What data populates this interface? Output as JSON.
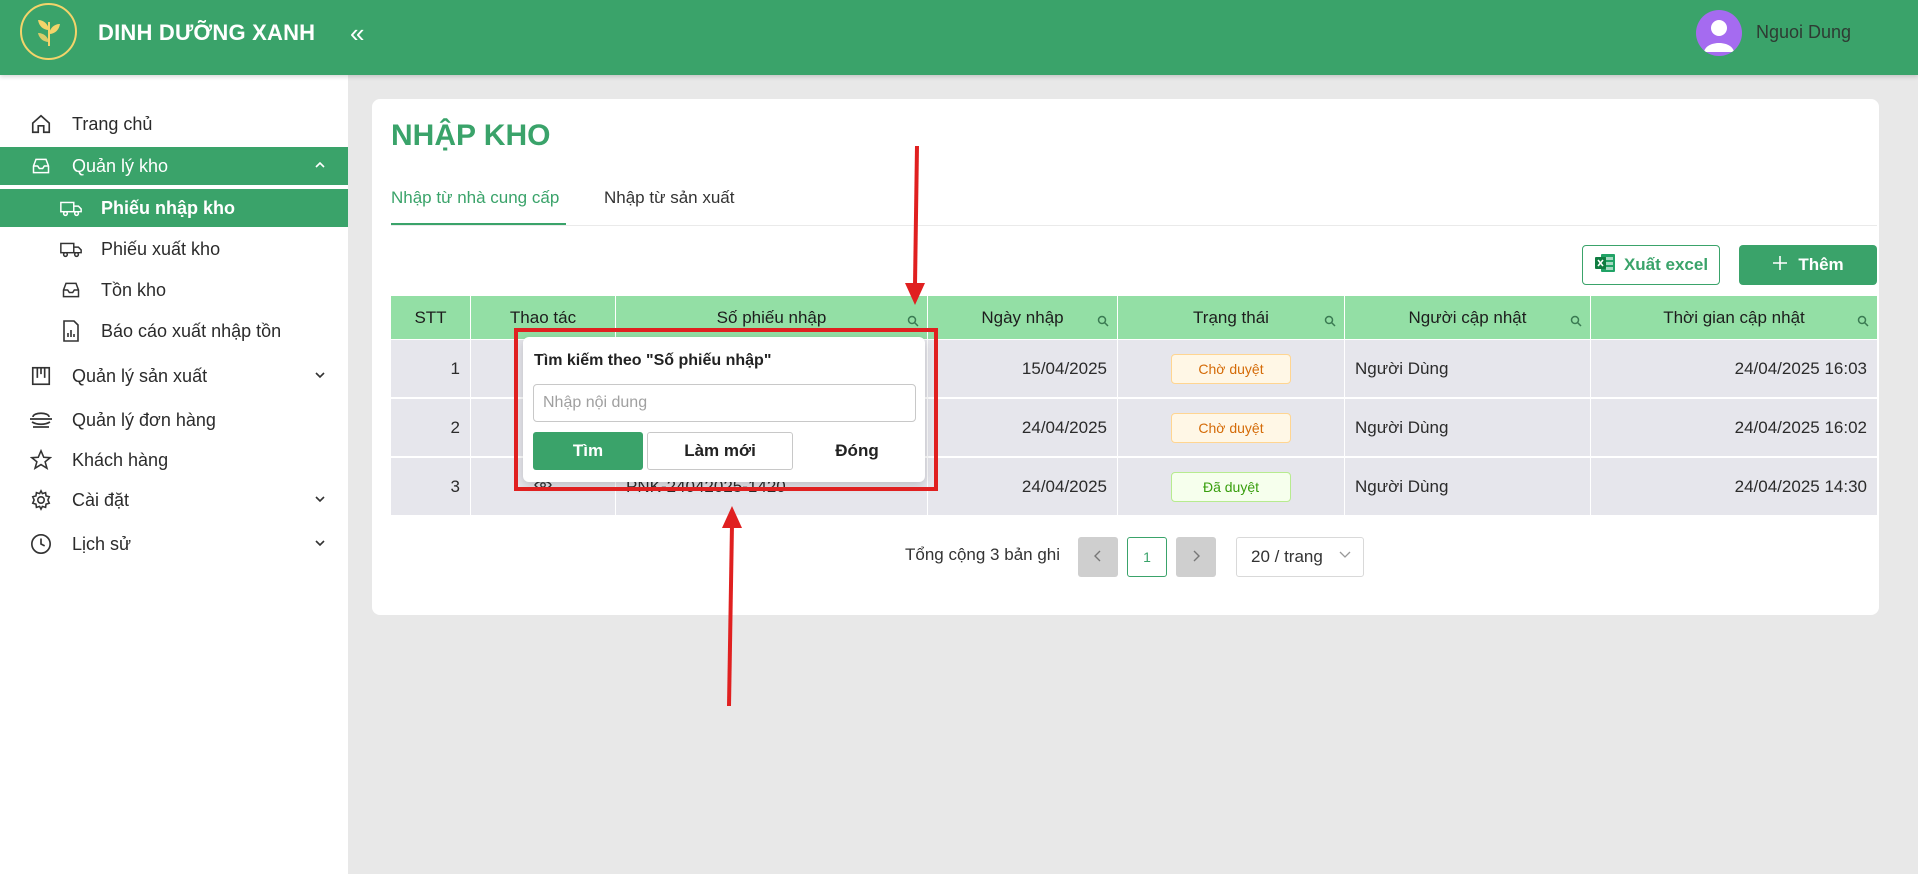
{
  "app": {
    "brand": "DINH DƯỠNG XANH",
    "collapse_glyph": "«",
    "user_name": "Nguoi Dung",
    "colors": {
      "primary": "#3aa36a",
      "header_row": "#93dfa5",
      "highlight": "#e02020"
    }
  },
  "sidebar": {
    "items": [
      {
        "label": "Trang chủ",
        "icon": "home-icon"
      },
      {
        "label": "Quản lý kho",
        "icon": "inbox-icon",
        "chevron": "up"
      },
      {
        "label": "Phiếu nhập kho",
        "icon": "truck-in-icon"
      },
      {
        "label": "Phiếu xuất kho",
        "icon": "truck-out-icon"
      },
      {
        "label": "Tồn kho",
        "icon": "inbox-icon"
      },
      {
        "label": "Báo cáo xuất nhập tồn",
        "icon": "report-icon"
      },
      {
        "label": "Quản lý sản xuất",
        "icon": "factory-icon",
        "chevron": "down"
      },
      {
        "label": "Quản lý đơn hàng",
        "icon": "order-icon"
      },
      {
        "label": "Khách hàng",
        "icon": "star-icon"
      },
      {
        "label": "Cài đặt",
        "icon": "gear-icon",
        "chevron": "down"
      },
      {
        "label": "Lịch sử",
        "icon": "clock-icon",
        "chevron": "down"
      }
    ]
  },
  "main": {
    "title": "NHẬP KHO",
    "tabs": [
      {
        "label": "Nhập từ nhà cung cấp",
        "active": true
      },
      {
        "label": "Nhập từ sản xuất",
        "active": false
      }
    ],
    "actions": {
      "export_label": "Xuất excel",
      "add_label": "Thêm"
    }
  },
  "table": {
    "columns": [
      "STT",
      "Thao tác",
      "Số phiếu nhập",
      "Ngày nhập",
      "Trạng thái",
      "Người cập nhật",
      "Thời gian cập nhật"
    ],
    "rows": [
      {
        "stt": "1",
        "action_icon": "edit-icon",
        "code": "",
        "date": "15/04/2025",
        "status": "Chờ duyệt",
        "user": "Người Dùng",
        "updated": "24/04/2025 16:03"
      },
      {
        "stt": "2",
        "action_icon": "edit-icon",
        "code": "",
        "date": "24/04/2025",
        "status": "Chờ duyệt",
        "user": "Người Dùng",
        "updated": "24/04/2025 16:02"
      },
      {
        "stt": "3",
        "action_icon": "eye-icon",
        "code": "PNK-24042025-1420",
        "date": "24/04/2025",
        "status": "Đã duyệt",
        "user": "Người Dùng",
        "updated": "24/04/2025 14:30"
      }
    ]
  },
  "pagination": {
    "total": "Tổng cộng 3 bản ghi",
    "current_page": "1",
    "page_size": "20 / trang"
  },
  "search_popup": {
    "title": "Tìm kiếm theo \"Số phiếu nhập\"",
    "placeholder": "Nhập nội dung",
    "find_label": "Tìm",
    "reset_label": "Làm mới",
    "close_label": "Đóng"
  }
}
